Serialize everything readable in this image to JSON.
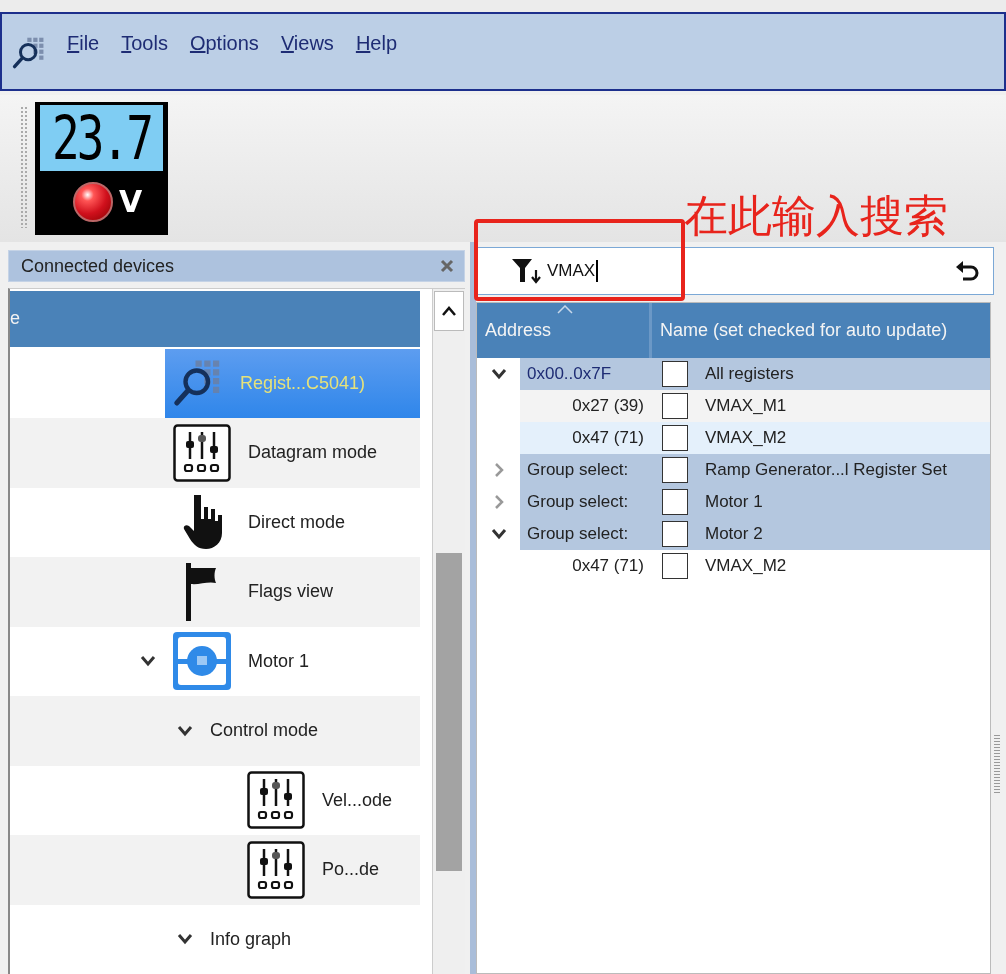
{
  "menu": {
    "items": [
      {
        "label": "File"
      },
      {
        "label": "Tools"
      },
      {
        "label": "Options"
      },
      {
        "label": "Views"
      },
      {
        "label": "Help"
      }
    ]
  },
  "toolbar": {
    "voltage_display": {
      "reading": "23.7",
      "unit": "V"
    }
  },
  "annotation": {
    "text": "在此输入搜索"
  },
  "devices_panel": {
    "title": "Connected devices",
    "tree_header": "e",
    "items": [
      {
        "label": "Regist...C5041)",
        "kind": "register-view",
        "selected": true
      },
      {
        "label": "Datagram mode",
        "kind": "sliders",
        "selected": false
      },
      {
        "label": "Direct mode",
        "kind": "hand",
        "selected": false
      },
      {
        "label": "Flags view",
        "kind": "flag",
        "selected": false
      },
      {
        "label": "Motor 1",
        "kind": "motor",
        "selected": false,
        "expanded": true,
        "children": [
          {
            "label": "Control mode",
            "selected": false,
            "expanded": true,
            "children": [
              {
                "label": "Vel...ode",
                "kind": "sliders",
                "selected": false
              },
              {
                "label": "Po...de",
                "kind": "sliders",
                "selected": false
              }
            ]
          },
          {
            "label": "Info graph",
            "selected": false,
            "expanded": true
          }
        ]
      }
    ]
  },
  "register_panel": {
    "search": {
      "value": "VMAX"
    },
    "table": {
      "columns": [
        "Address",
        "Name (set checked for auto update)"
      ],
      "rows": [
        {
          "kind": "group",
          "address": "0x00..0x7F",
          "name": "All registers",
          "checked": false,
          "selected": false,
          "expanded": true,
          "children": [
            {
              "kind": "register",
              "address": "0x27 (39)",
              "name": "VMAX_M1",
              "checked": false,
              "selected": false
            },
            {
              "kind": "register",
              "address": "0x47 (71)",
              "name": "VMAX_M2",
              "checked": false,
              "selected": true
            }
          ]
        },
        {
          "kind": "group",
          "address": "Group select:",
          "name": "Ramp Generator...l Register Set",
          "checked": false,
          "selected": false,
          "expanded": false
        },
        {
          "kind": "group",
          "address": "Group select:",
          "name": "Motor 1",
          "checked": false,
          "selected": false,
          "expanded": false
        },
        {
          "kind": "group",
          "address": "Group select:",
          "name": "Motor 2",
          "checked": false,
          "selected": false,
          "expanded": true,
          "children": [
            {
              "kind": "register",
              "address": "0x47 (71)",
              "name": "VMAX_M2",
              "checked": false,
              "selected": false
            }
          ]
        }
      ]
    }
  }
}
